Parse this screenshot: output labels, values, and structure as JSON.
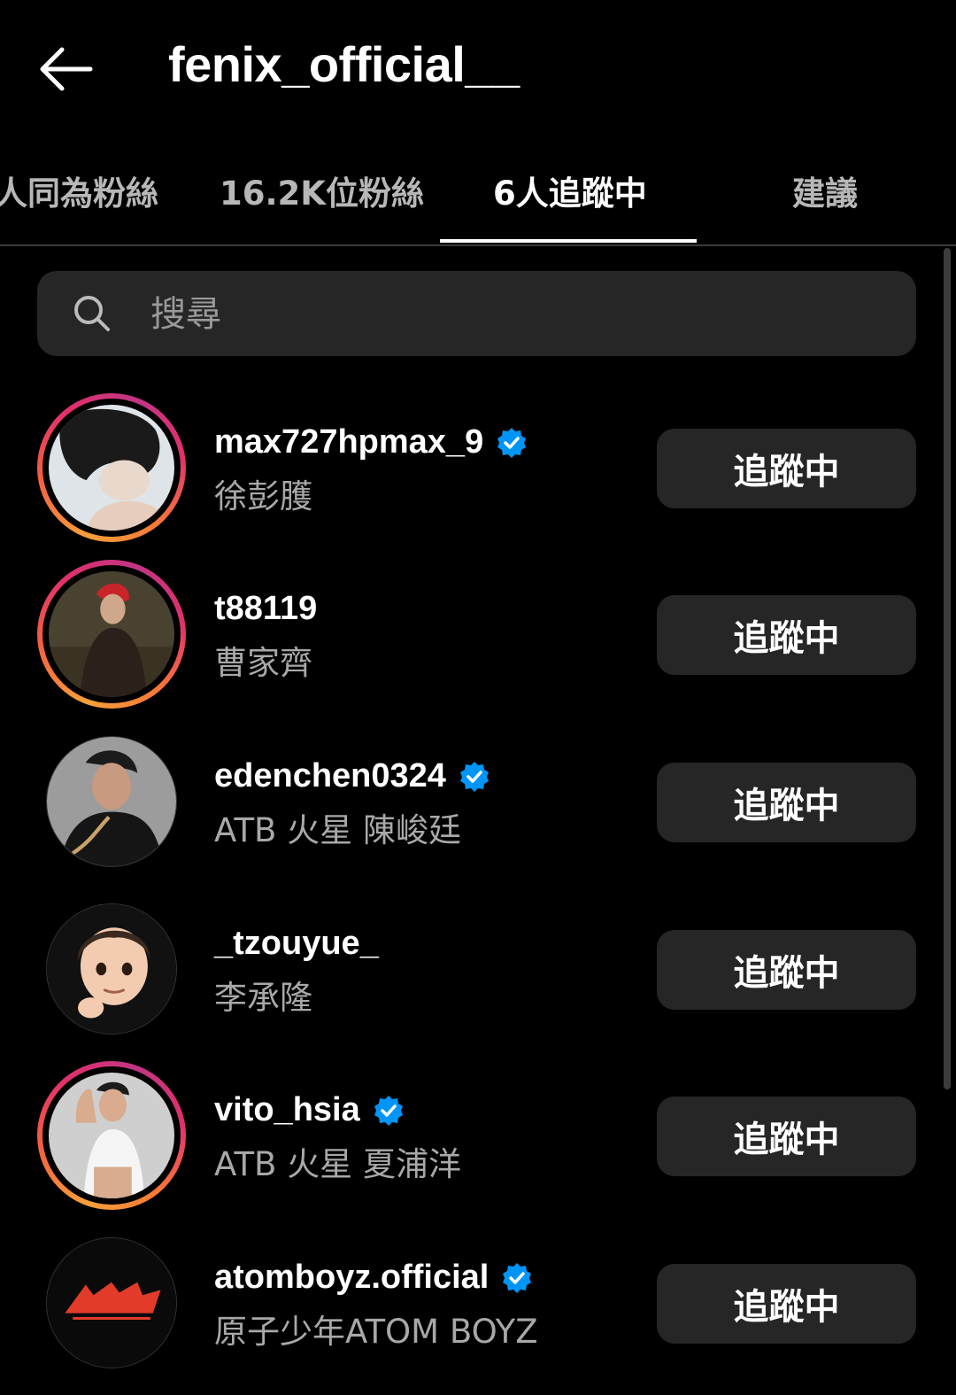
{
  "header": {
    "title": "fenix_official__",
    "back_icon": "arrow-left-icon"
  },
  "tabs": [
    {
      "label": "人同為粉絲",
      "active": false
    },
    {
      "label": "16.2K位粉絲",
      "active": false
    },
    {
      "label": "6人追蹤中",
      "active": true
    },
    {
      "label": "建議",
      "active": false
    }
  ],
  "search": {
    "placeholder": "搜尋",
    "icon": "search-icon"
  },
  "following": [
    {
      "username": "max727hpmax_9",
      "full_name": "徐彭臒",
      "verified": true,
      "story_ring": true,
      "button": "追蹤中"
    },
    {
      "username": "t88119",
      "full_name": "曹家齊",
      "verified": false,
      "story_ring": true,
      "button": "追蹤中"
    },
    {
      "username": "edenchen0324",
      "full_name": "ATB 火星 陳峻廷",
      "verified": true,
      "story_ring": false,
      "button": "追蹤中"
    },
    {
      "username": "_tzouyue_",
      "full_name": "李承隆",
      "verified": false,
      "story_ring": false,
      "button": "追蹤中"
    },
    {
      "username": "vito_hsia",
      "full_name": "ATB 火星 夏浦洋",
      "verified": true,
      "story_ring": true,
      "button": "追蹤中"
    },
    {
      "username": "atomboyz.official",
      "full_name": "原子少年ATOM BOYZ",
      "verified": true,
      "story_ring": false,
      "button": "追蹤中"
    }
  ],
  "colors": {
    "background": "#000000",
    "button_bg": "#262626",
    "verified": "#0095f6",
    "secondary_text": "#a8a8a8"
  }
}
